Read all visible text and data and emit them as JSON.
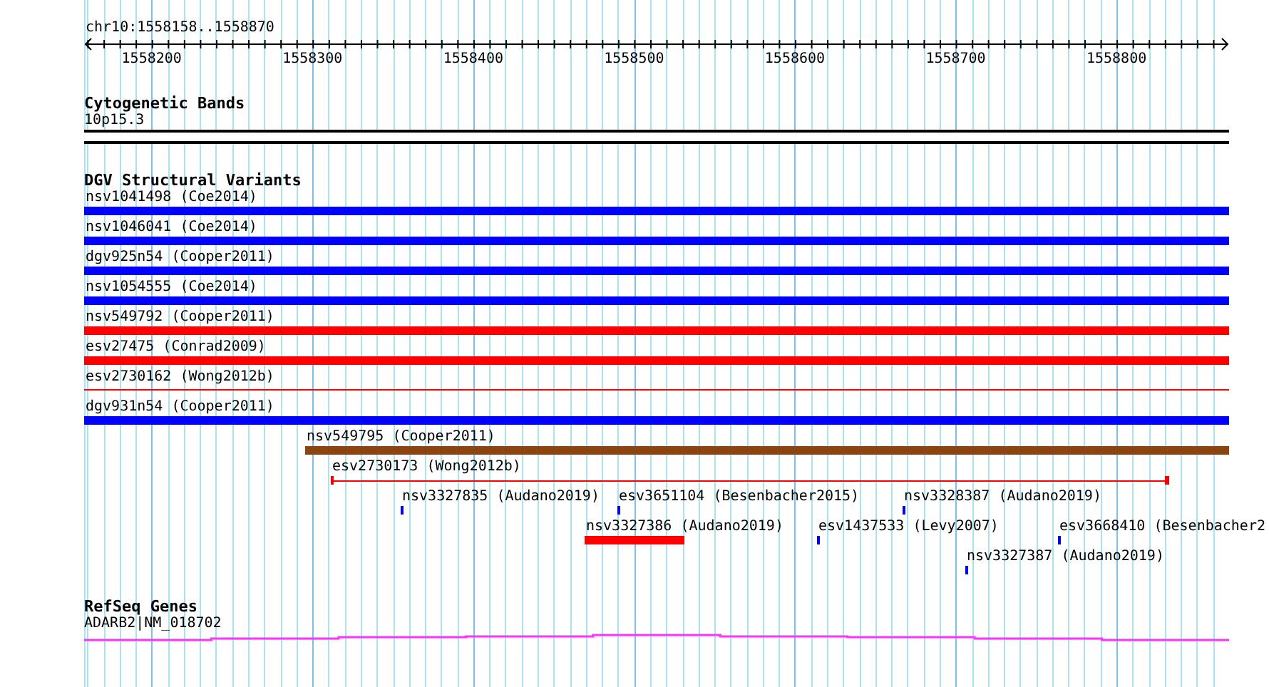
{
  "ruler": {
    "location": "chr10:1558158..1558870",
    "ticks": [
      "1558200",
      "1558300",
      "1558400",
      "1558500",
      "1558600",
      "1558700",
      "1558800"
    ]
  },
  "cytoband": {
    "title": "Cytogenetic Bands",
    "band": "10p15.3"
  },
  "dgv": {
    "title": "DGV Structural Variants",
    "rows": [
      {
        "features": [
          {
            "label": "nsv1041498 (Coe2014)",
            "kind": "bar",
            "color": "#0000ff"
          }
        ]
      },
      {
        "features": [
          {
            "label": "nsv1046041 (Coe2014)",
            "kind": "bar",
            "color": "#0000ff"
          }
        ]
      },
      {
        "features": [
          {
            "label": "dgv925n54 (Cooper2011)",
            "kind": "bar",
            "color": "#0000ff"
          }
        ]
      },
      {
        "features": [
          {
            "label": "nsv1054555 (Coe2014)",
            "kind": "bar",
            "color": "#0000ff"
          }
        ]
      },
      {
        "features": [
          {
            "label": "nsv549792 (Cooper2011)",
            "kind": "bar",
            "color": "#ff0000"
          }
        ]
      },
      {
        "features": [
          {
            "label": "esv27475 (Conrad2009)",
            "kind": "bar",
            "color": "#ff0000"
          }
        ]
      },
      {
        "features": [
          {
            "label": "esv2730162 (Wong2012b)",
            "kind": "line",
            "color": "#ff0000"
          }
        ]
      },
      {
        "features": [
          {
            "label": "dgv931n54 (Cooper2011)",
            "kind": "bar",
            "color": "#0000ff"
          }
        ]
      },
      {
        "features": [
          {
            "label": "nsv549795 (Cooper2011)",
            "kind": "bar",
            "color": "#8b4513"
          }
        ]
      },
      {
        "features": [
          {
            "label": "esv2730173 (Wong2012b)",
            "kind": "capped-line",
            "color": "#ff0000"
          }
        ]
      },
      {
        "features": [
          {
            "label": "nsv3327835 (Audano2019)",
            "kind": "bar",
            "color": "#0000ff"
          },
          {
            "label": "esv3651104 (Besenbacher2015)",
            "kind": "bar",
            "color": "#0000ff"
          },
          {
            "label": "nsv3328387 (Audano2019)",
            "kind": "bar",
            "color": "#0000ff"
          }
        ]
      },
      {
        "features": [
          {
            "label": "nsv3327386 (Audano2019)",
            "kind": "bar",
            "color": "#ff0000"
          },
          {
            "label": "esv1437533 (Levy2007)",
            "kind": "bar",
            "color": "#0000ff"
          },
          {
            "label": "esv3668410 (Besenbacher2",
            "kind": "bar",
            "color": "#0000ff"
          }
        ]
      },
      {
        "features": [
          {
            "label": "nsv3327387 (Audano2019)",
            "kind": "bar",
            "color": "#0000ff"
          }
        ]
      }
    ]
  },
  "refseq": {
    "title": "RefSeq Genes",
    "gene": "ADARB2|NM_018702"
  }
}
